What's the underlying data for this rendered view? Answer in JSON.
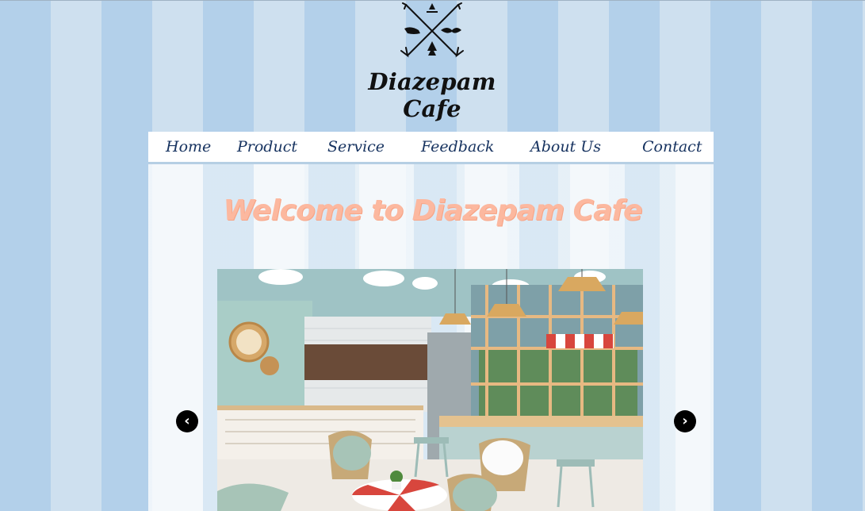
{
  "site": {
    "brand_name": "Diazepam Cafe"
  },
  "nav": {
    "items": [
      {
        "label": "Home"
      },
      {
        "label": "Product"
      },
      {
        "label": "Service"
      },
      {
        "label": "Feedback"
      },
      {
        "label": "About Us"
      },
      {
        "label": "Contact"
      }
    ]
  },
  "hero": {
    "heading": "Welcome to Diazepam Cafe"
  },
  "slider": {
    "prev_icon": "chevron-left-icon",
    "next_icon": "chevron-right-icon",
    "prev_glyph": "‹",
    "next_glyph": "›"
  },
  "colors": {
    "stripe_dark": "#b3d0ea",
    "stripe_light": "#cee0ef",
    "nav_text": "#173360",
    "heading": "#fcb89f"
  }
}
